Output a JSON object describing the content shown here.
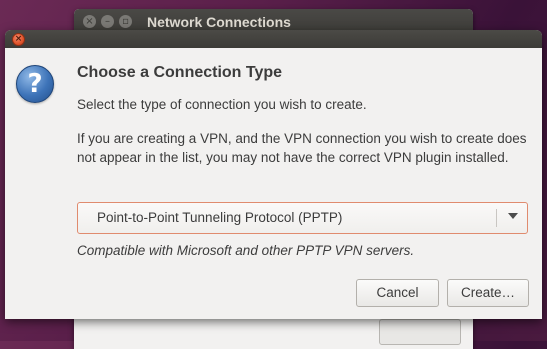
{
  "background_window": {
    "title": "Network Connections"
  },
  "dialog": {
    "heading": "Choose a Connection Type",
    "subtitle": "Select the type of connection you wish to create.",
    "info": "If you are creating a VPN, and the VPN connection you wish to create does not appear in the list, you may not have the correct VPN plugin installed.",
    "connection_type": {
      "selected": "Point-to-Point Tunneling Protocol (PPTP)"
    },
    "hint": "Compatible with Microsoft and other PPTP VPN servers.",
    "buttons": {
      "cancel": "Cancel",
      "create": "Create…"
    }
  },
  "colors": {
    "titlebar": "#3c3b37",
    "close": "#e0532a",
    "accent_border": "#e08b6e",
    "info_icon": "#3d73b8"
  },
  "icons": {
    "close": "close-icon",
    "question": "question-icon",
    "dropdown": "chevron-down-icon"
  }
}
